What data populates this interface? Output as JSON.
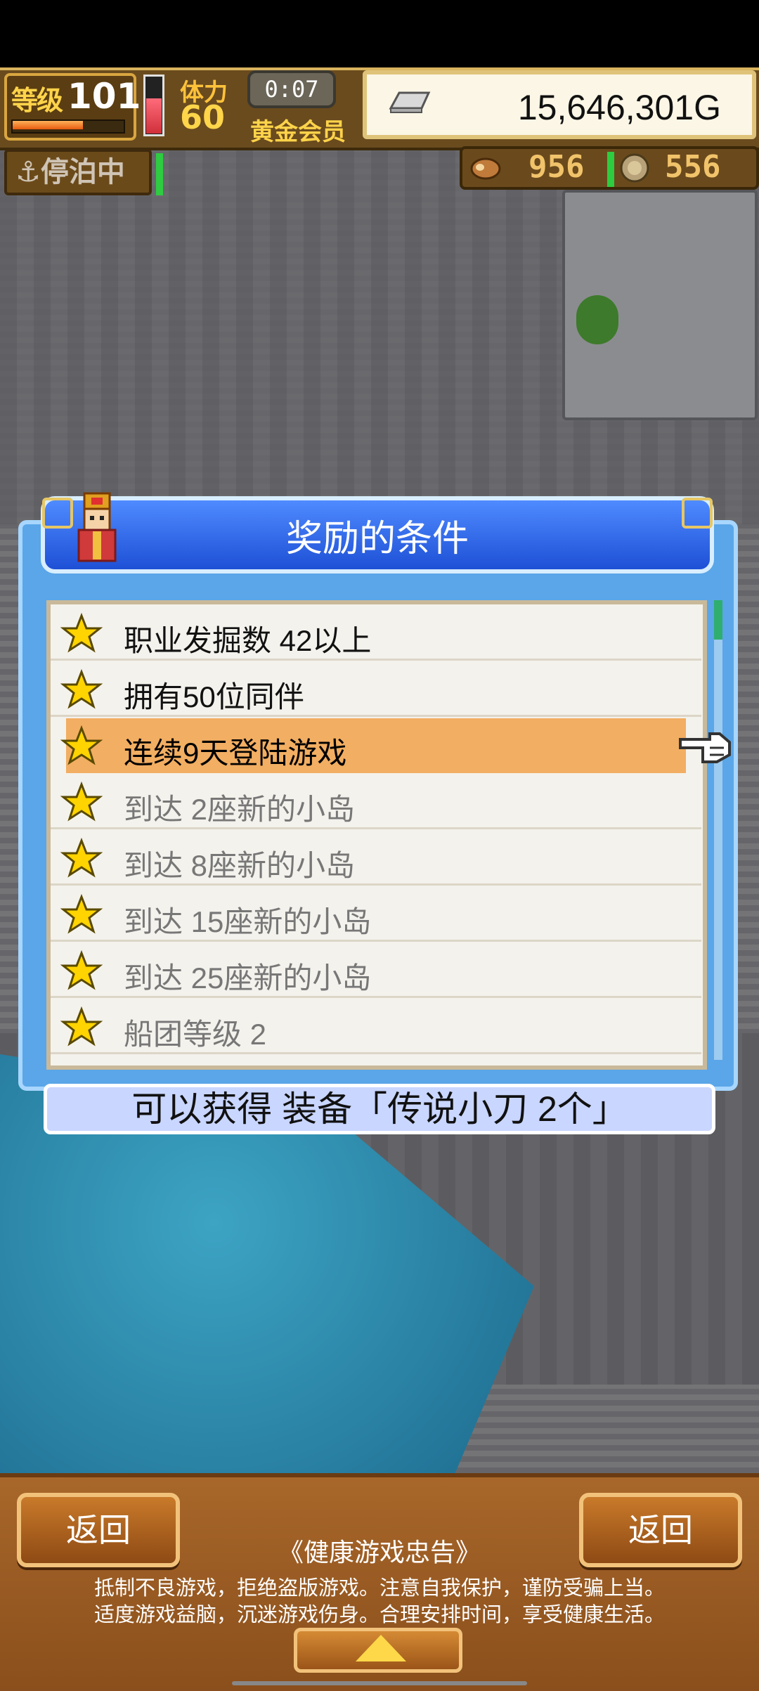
{
  "hud": {
    "level_label": "等级",
    "level_value": "101",
    "stamina_label": "体力",
    "stamina_value": "60",
    "timer": "0:07",
    "membership": "黄金会员",
    "money": "15,646,301G",
    "docked_status": "停泊中",
    "resource_1": "956",
    "resource_2": "556"
  },
  "dialog": {
    "title": "奖励的条件",
    "conditions": [
      {
        "label": "职业发掘数 42以上",
        "state": "active"
      },
      {
        "label": "拥有50位同伴",
        "state": "active"
      },
      {
        "label": "连续9天登陆游戏",
        "state": "highlight"
      },
      {
        "label": "到达 2座新的小岛",
        "state": "inactive"
      },
      {
        "label": "到达 8座新的小岛",
        "state": "inactive"
      },
      {
        "label": "到达 15座新的小岛",
        "state": "inactive"
      },
      {
        "label": "到达 25座新的小岛",
        "state": "inactive"
      },
      {
        "label": "船团等级 2",
        "state": "inactive"
      }
    ],
    "reward_text": "可以获得 装备「传说小刀 2个」"
  },
  "bottom": {
    "back_left": "返回",
    "back_right": "返回",
    "notice_title": "《健康游戏忠告》",
    "notice_line1": "抵制不良游戏，拒绝盗版游戏。注意自我保护，谨防受骗上当。",
    "notice_line2": "适度游戏益脑，沉迷游戏伤身。合理安排时间，享受健康生活。"
  },
  "colors": {
    "dialog_blue": "#5aa6e8",
    "title_blue": "#1e50d6",
    "highlight_orange": "#f2ae62",
    "star_yellow": "#ffd400"
  }
}
